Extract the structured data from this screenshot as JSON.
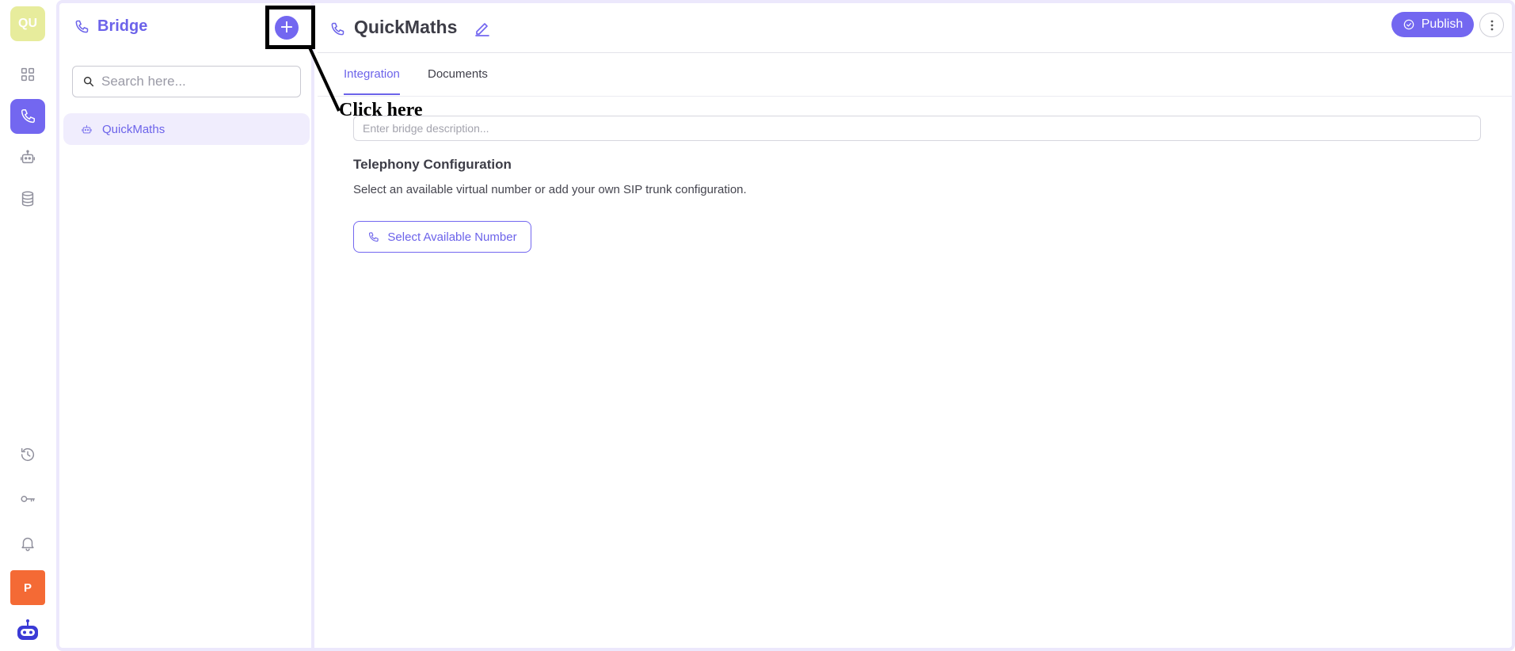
{
  "rail": {
    "workspace_initials": "QU",
    "profile_initial": "P",
    "items": [
      {
        "icon": "dashboard-icon"
      },
      {
        "icon": "phone-icon",
        "active": true
      },
      {
        "icon": "robot-icon"
      },
      {
        "icon": "database-icon"
      },
      {
        "icon": "history-icon"
      },
      {
        "icon": "key-icon"
      },
      {
        "icon": "bell-icon"
      }
    ]
  },
  "sidebar": {
    "title": "Bridge",
    "add_label": "+",
    "search_placeholder": "Search here...",
    "items": [
      {
        "label": "QuickMaths",
        "selected": true
      }
    ]
  },
  "header": {
    "title": "QuickMaths",
    "publish_label": "Publish"
  },
  "tabs": [
    {
      "label": "Integration",
      "active": true
    },
    {
      "label": "Documents",
      "active": false
    }
  ],
  "content": {
    "description_placeholder": "Enter bridge description...",
    "telephony_title": "Telephony Configuration",
    "telephony_subtitle": "Select an available virtual number or add your own SIP trunk configuration.",
    "select_number_label": "Select Available Number"
  },
  "annotation": {
    "text": "Click here"
  },
  "colors": {
    "accent": "#7367f0",
    "accent_light": "#f0edfd",
    "workspace_badge": "#e7ec9c",
    "profile_badge": "#f46a35",
    "frame_border": "#ece8fc"
  }
}
